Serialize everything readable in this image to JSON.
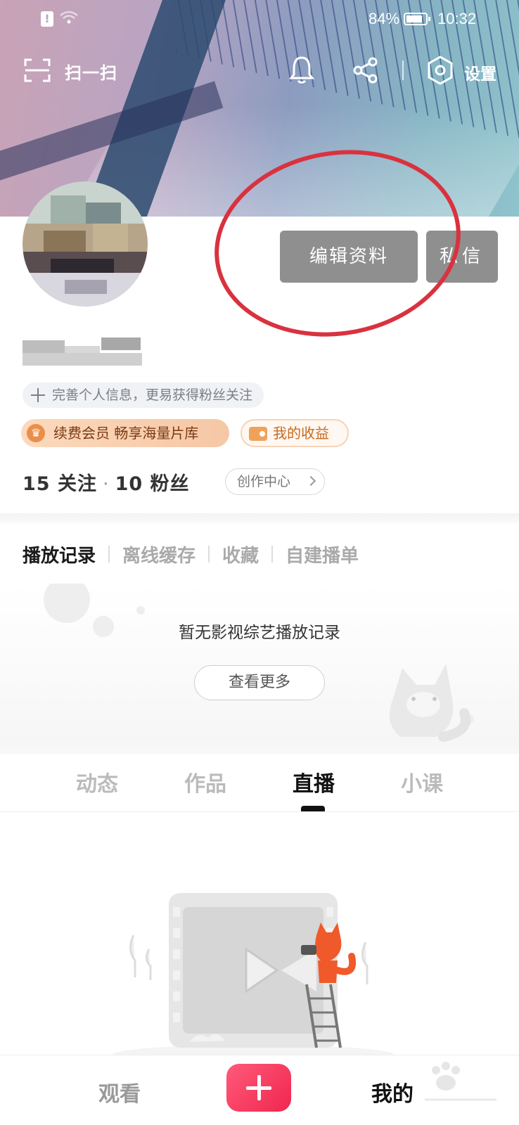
{
  "status_bar": {
    "battery": "84%",
    "battery_level": 0.84,
    "time": "10:32"
  },
  "top_bar": {
    "scan_label": "扫一扫",
    "settings_label": "设置"
  },
  "profile": {
    "edit_button": "编辑资料",
    "message_button": "私信",
    "complete_info": "完善个人信息，更易获得粉丝关注",
    "vip_label": "续费会员 畅享海量片库",
    "income_label": "我的收益",
    "following": "15 关注",
    "followers": "10 粉丝",
    "creator_center": "创作中心"
  },
  "history": {
    "tabs": [
      {
        "label": "播放记录",
        "active": true
      },
      {
        "label": "离线缓存",
        "active": false
      },
      {
        "label": "收藏",
        "active": false
      },
      {
        "label": "自建播单",
        "active": false
      }
    ],
    "empty_text": "暂无影视综艺播放记录",
    "more_button": "查看更多"
  },
  "content_tabs": [
    {
      "label": "动态",
      "active": false
    },
    {
      "label": "作品",
      "active": false
    },
    {
      "label": "直播",
      "active": true
    },
    {
      "label": "小课",
      "active": false
    }
  ],
  "bottom_nav": {
    "watch": "观看",
    "mine": "我的"
  },
  "colors": {
    "accent": "#f0264f",
    "highlight_circle": "#d9323f",
    "button_gray": "#8f8f8f"
  },
  "icons": [
    "sim-alert-icon",
    "wifi-icon",
    "battery-icon",
    "scan-icon",
    "bell-icon",
    "share-icon",
    "gear-icon",
    "plus-icon",
    "crown-icon",
    "wallet-icon",
    "chevron-right-icon",
    "fox-mascot",
    "add-icon"
  ]
}
